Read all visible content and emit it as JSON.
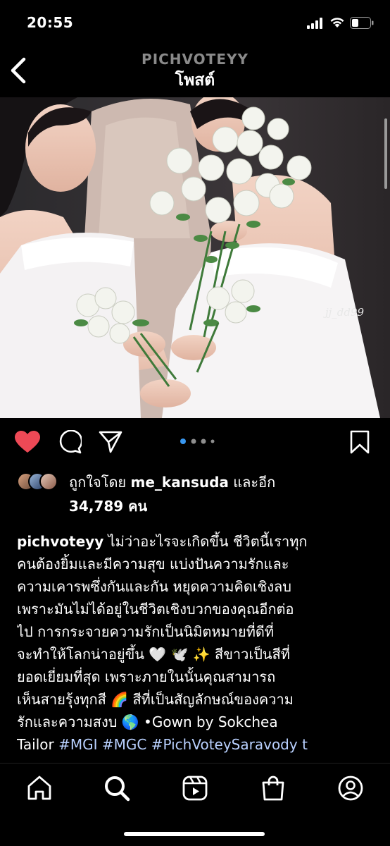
{
  "status_bar": {
    "time": "20:55",
    "icons": [
      "cellular-signal-icon",
      "wifi-icon",
      "battery-icon"
    ]
  },
  "header": {
    "account_name": "PICHVOTEYY",
    "title": "โพสต์",
    "back_icon": "chevron-left-icon"
  },
  "post": {
    "image_watermark": "jj_dd99",
    "carousel": {
      "count": 4,
      "active_index": 0
    },
    "actions": {
      "liked": true,
      "icons": [
        "heart-filled-icon",
        "comment-icon",
        "share-icon",
        "bookmark-icon"
      ]
    },
    "likes": {
      "prefix": "ถูกใจโดย ",
      "user": "me_kansuda",
      "suffix": " และอีก",
      "count_text": "34,789 คน"
    },
    "caption": {
      "username": "pichvoteyy",
      "lines": [
        " ไม่ว่าอะไรจะเกิดขึ้น ชีวิตนี้เราทุก",
        "คนต้องยิ้มและมีความสุข แบ่งปันความรักและ",
        "ความเคารพซึ่งกันและกัน หยุดความคิดเชิงลบ",
        "เพราะมันไม่ได้อยู่ในชีวิตเชิงบวกของคุณอีกต่อ",
        "ไป การกระจายความรักเป็นนิมิตหมายที่ดีที่",
        "จะทำให้โลกน่าอยู่ขึ้น 🤍 🕊️ ✨ สีขาวเป็นสีที่",
        "ยอดเยี่ยมที่สุด เพราะภายในนั้นคุณสามารถ",
        "เห็นสายรุ้งทุกสี 🌈 สีที่เป็นสัญลักษณ์ของความ",
        "รักและความสงบ 🌎 •Gown by Sokchea"
      ],
      "last_line_prefix": "Tailor ",
      "hashtags": [
        "#MGI",
        "#MGC",
        "#PichVoteySaravody t"
      ]
    }
  },
  "tab_bar": {
    "items": [
      "home-icon",
      "search-icon",
      "reels-icon",
      "shop-icon",
      "profile-icon"
    ],
    "active": "search-icon"
  },
  "colors": {
    "background": "#000000",
    "heart": "#ed4956",
    "hashtag": "#b9d1ff",
    "carousel_active": "#3897f0",
    "muted_header": "#8a8a8a"
  }
}
